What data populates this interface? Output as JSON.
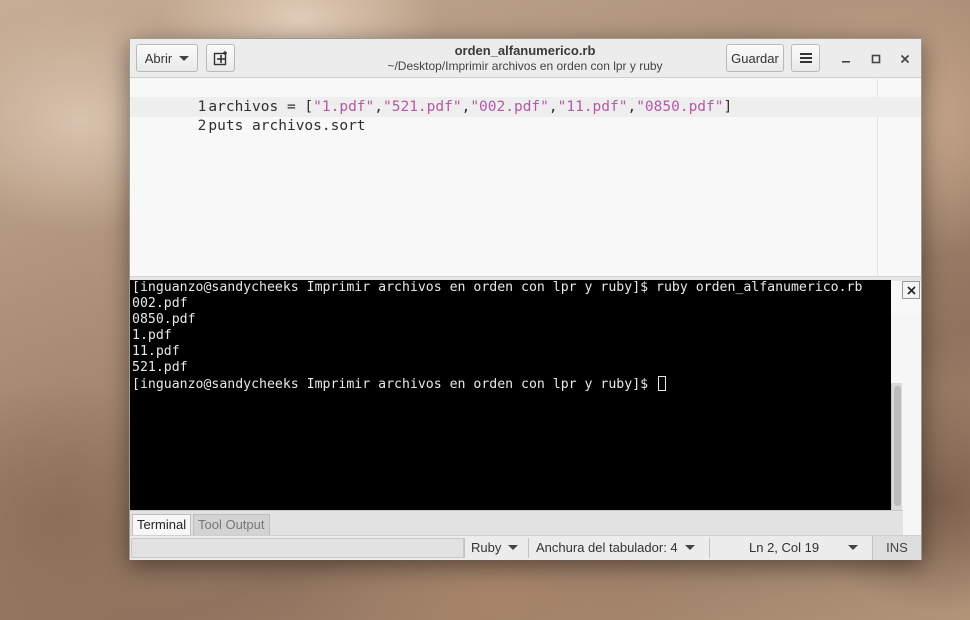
{
  "window": {
    "title": "orden_alfanumerico.rb",
    "subtitle": "~/Desktop/Imprimir archivos en orden con lpr y ruby"
  },
  "toolbar": {
    "open_label": "Abrir",
    "save_label": "Guardar",
    "new_tab_icon": "new-document-icon",
    "menu_icon": "hamburger-menu-icon"
  },
  "editor": {
    "lines": [
      {
        "number": "1",
        "prefix": "archivos = [",
        "tokens": [
          "\"1.pdf\"",
          ",",
          "\"521.pdf\"",
          ",",
          "\"002.pdf\"",
          ",",
          "\"11.pdf\"",
          ",",
          "\"0850.pdf\"",
          "]"
        ]
      },
      {
        "number": "2",
        "text": "puts archivos.sort"
      }
    ]
  },
  "terminal": {
    "lines": [
      "[inguanzo@sandycheeks Imprimir archivos en orden con lpr y ruby]$ ruby orden_alfanumerico.rb",
      "002.pdf",
      "0850.pdf",
      "1.pdf",
      "11.pdf",
      "521.pdf"
    ],
    "prompt": "[inguanzo@sandycheeks Imprimir archivos en orden con lpr y ruby]$ "
  },
  "bottom_tabs": [
    {
      "label": "Terminal",
      "active": true
    },
    {
      "label": "Tool Output",
      "active": false
    }
  ],
  "statusbar": {
    "language": "Ruby",
    "tab_width": "Anchura del tabulador: 4",
    "position": "Ln 2, Col 19",
    "mode": "INS"
  },
  "colors": {
    "string": "#b35aa6",
    "terminal_bg": "#000000",
    "terminal_fg": "#e8e8e8"
  }
}
